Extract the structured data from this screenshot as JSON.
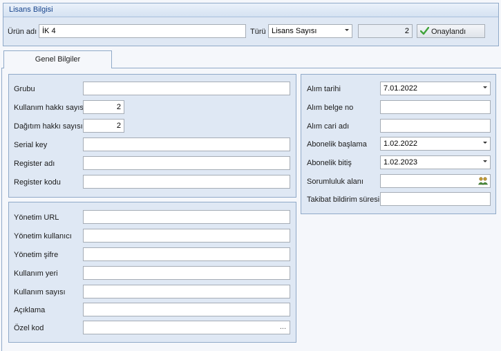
{
  "license_group": {
    "title": "Lisans Bilgisi",
    "product_label": "Ürün adı",
    "product_value": "İK 4",
    "type_label": "Türü",
    "type_value": "Lisans Sayısı",
    "count_value": "2",
    "approved_label": "Onaylandı"
  },
  "tabs": [
    {
      "label": "Genel Bilgiler"
    }
  ],
  "left_top": {
    "group_label": "Grubu",
    "group_value": "",
    "usage_rights_label": "Kullanım hakkı sayısı",
    "usage_rights_value": "2",
    "distribution_rights_label": "Dağıtım hakkı sayısı",
    "distribution_rights_value": "2",
    "serial_label": "Serial key",
    "serial_value": "",
    "register_name_label": "Register adı",
    "register_name_value": "",
    "register_code_label": "Register kodu",
    "register_code_value": ""
  },
  "left_bottom": {
    "admin_url_label": "Yönetim URL",
    "admin_url_value": "",
    "admin_user_label": "Yönetim kullanıcı",
    "admin_user_value": "",
    "admin_password_label": "Yönetim şifre",
    "admin_password_value": "",
    "usage_place_label": "Kullanım yeri",
    "usage_place_value": "",
    "usage_count_label": "Kullanım sayısı",
    "usage_count_value": "",
    "description_label": "Açıklama",
    "description_value": "",
    "special_code_label": "Özel kod",
    "special_code_value": "",
    "special_code_button": "..."
  },
  "right": {
    "purchase_date_label": "Alım tarihi",
    "purchase_date_value": "7.01.2022",
    "purchase_doc_label": "Alım belge no",
    "purchase_doc_value": "",
    "purchase_account_label": "Alım cari adı",
    "purchase_account_value": "",
    "sub_start_label": "Abonelik başlama",
    "sub_start_value": "1.02.2022",
    "sub_end_label": "Abonelik bitiş",
    "sub_end_value": "1.02.2023",
    "responsibility_label": "Sorumluluk alanı",
    "responsibility_value": "",
    "followup_label": "Takibat bildirim süresi",
    "followup_value": ""
  },
  "colors": {
    "accent": "#15428b",
    "panel_bg": "#dfe8f4",
    "border": "#8fa9c8",
    "check_green": "#3fa33a"
  }
}
